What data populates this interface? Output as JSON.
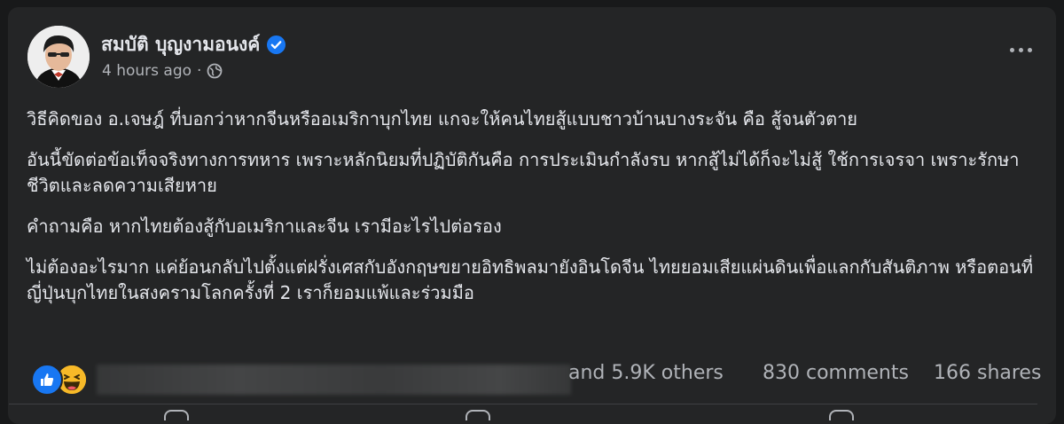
{
  "post": {
    "author": "สมบัติ บุญงามอนงค์",
    "time": "4 hours ago",
    "separator": "·",
    "paragraphs": [
      "วิธีคิดของ อ.เจษฎ์ ที่บอกว่าหากจีนหรืออเมริกาบุกไทย แกจะให้คนไทยสู้แบบชาวบ้านบางระจัน คือ สู้จนตัวตาย",
      "อันนี้ขัดต่อข้อเท็จจริงทางการทหาร เพราะหลักนิยมที่ปฏิบัติกันคือ การประเมินกำลังรบ หากสู้ไม่ได้ก็จะไม่สู้ ใช้การเจรจา เพราะรักษาชีวิตและลดความเสียหาย",
      "คำถามคือ หากไทยต้องสู้กับอเมริกาและจีน เรามีอะไรไปต่อรอง",
      "ไม่ต้องอะไรมาก แค่ย้อนกลับไปตั้งแต่ฝรั่งเศสกับอังกฤษขยายอิทธิพลมายังอินโดจีน ไทยยอมเสียแผ่นดินเพื่อแลกกับสันติภาพ หรือตอนที่ญี่ปุ่นบุกไทยในสงครามโลกครั้งที่ 2 เราก็ยอมแพ้และร่วมมือ"
    ],
    "reactions_others": "and 5.9K others",
    "comments": "830 comments",
    "shares": "166 shares"
  },
  "icons": {
    "verified": "verified-badge-icon",
    "privacy": "globe-icon",
    "more": "more-options-icon",
    "like": "like-reaction-icon",
    "haha": "haha-reaction-icon"
  },
  "colors": {
    "background": "#18191a",
    "card": "#242526",
    "text_primary": "#e4e6eb",
    "text_secondary": "#b0b3b8",
    "like_blue": "#1877f2",
    "haha_yellow": "#f7b928"
  }
}
